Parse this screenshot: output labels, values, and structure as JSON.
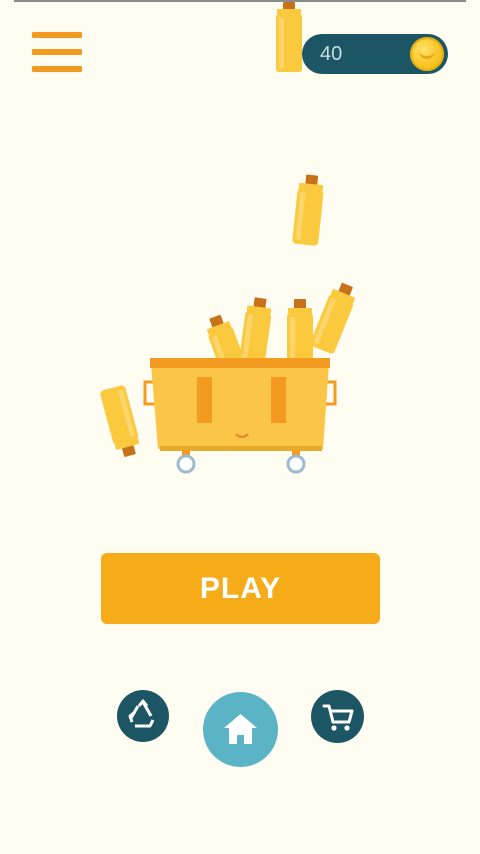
{
  "coins": {
    "count": "40"
  },
  "play_button": {
    "label": "PLAY"
  },
  "icons": {
    "menu": "hamburger-menu-icon",
    "coin": "coin-icon",
    "recycle": "recycle-icon",
    "home": "home-icon",
    "cart": "shopping-cart-icon"
  },
  "colors": {
    "background": "#fffcf1",
    "accent_orange": "#f39a20",
    "play_button": "#f6ac19",
    "teal_dark": "#1c5664",
    "teal_light": "#5ab4c6",
    "bottle_yellow": "#fbc93d",
    "dumpster_yellow": "#fbc548"
  }
}
